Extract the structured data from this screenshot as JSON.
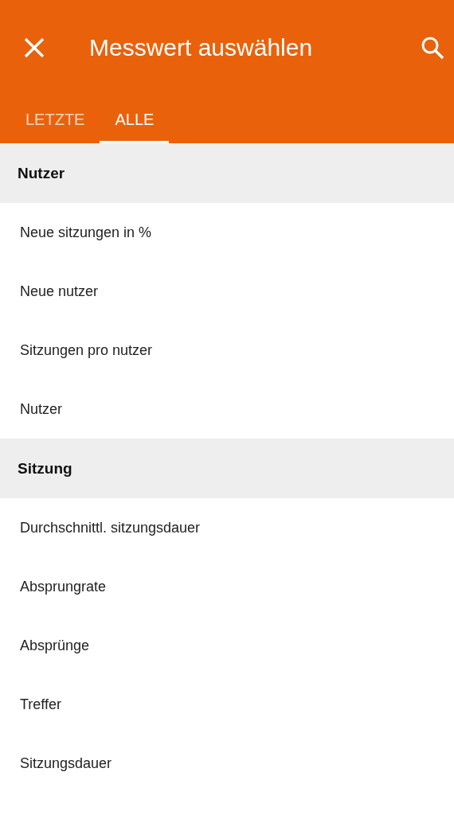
{
  "app_bar": {
    "title": "Messwert auswählen"
  },
  "tabs": [
    {
      "label": "LETZTE",
      "selected": false
    },
    {
      "label": "ALLE",
      "selected": true
    }
  ],
  "sections": [
    {
      "title": "Nutzer",
      "items": [
        "Neue sitzungen in %",
        "Neue nutzer",
        "Sitzungen pro nutzer",
        "Nutzer"
      ]
    },
    {
      "title": "Sitzung",
      "items": [
        "Durchschnittl. sitzungsdauer",
        "Absprungrate",
        "Absprünge",
        "Treffer",
        "Sitzungsdauer"
      ]
    }
  ]
}
